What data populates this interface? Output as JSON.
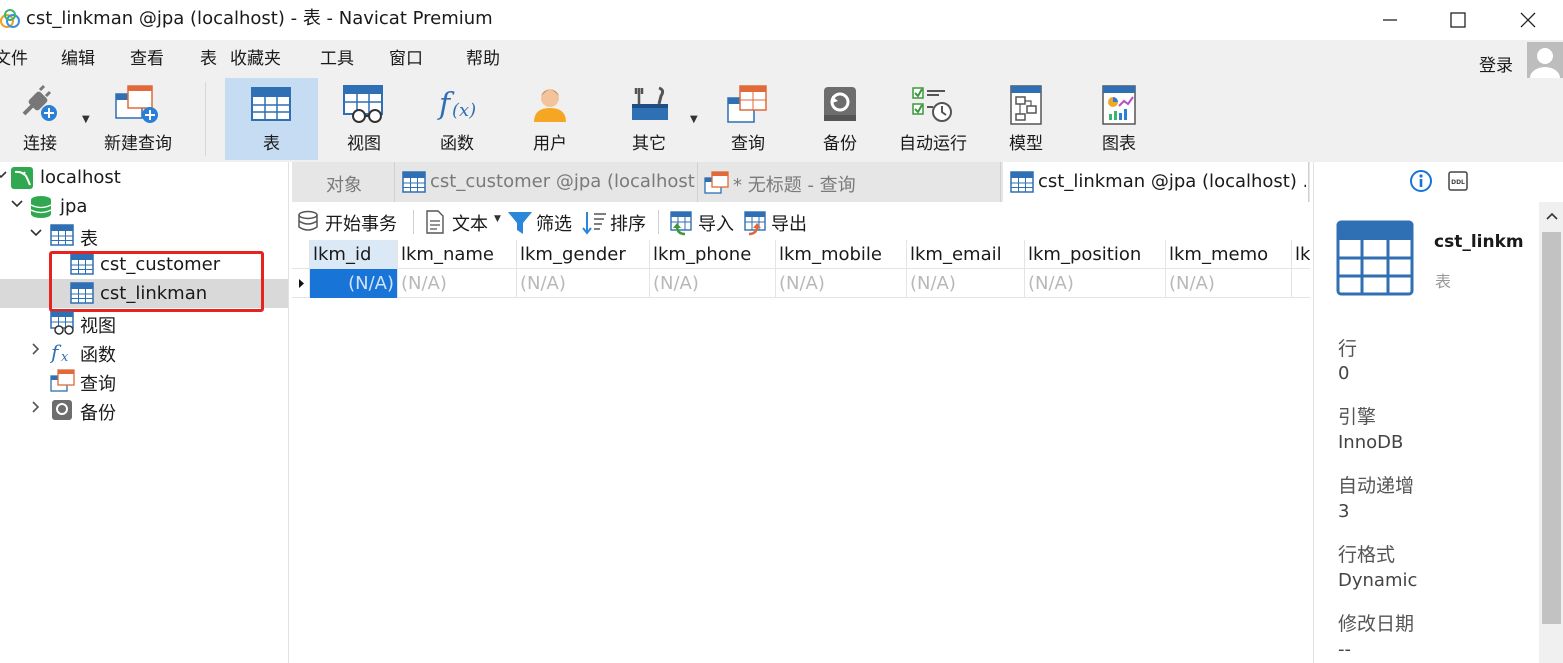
{
  "window": {
    "title": "cst_linkman @jpa (localhost) - 表 - Navicat Premium"
  },
  "menu": {
    "items": [
      "文件",
      "编辑",
      "查看",
      "表",
      "收藏夹",
      "工具",
      "窗口",
      "帮助"
    ],
    "login": "登录"
  },
  "toolbar": {
    "items": [
      "连接",
      "新建查询",
      "表",
      "视图",
      "函数",
      "用户",
      "其它",
      "查询",
      "备份",
      "自动运行",
      "模型",
      "图表"
    ],
    "active": "表"
  },
  "tree": {
    "connection": "localhost",
    "database": "jpa",
    "tables_group": "表",
    "tables": [
      "cst_customer",
      "cst_linkman"
    ],
    "selected_table": "cst_linkman",
    "views": "视图",
    "functions": "函数",
    "queries": "查询",
    "backups": "备份"
  },
  "tabs": [
    {
      "label": "对象",
      "active": false
    },
    {
      "label": "cst_customer @jpa (localhost...",
      "active": false
    },
    {
      "label": "* 无标题 - 查询",
      "active": false
    },
    {
      "label": "cst_linkman @jpa (localhost) ...",
      "active": true
    }
  ],
  "subtoolbar": {
    "begin_transaction": "开始事务",
    "text": "文本",
    "filter": "筛选",
    "sort": "排序",
    "import": "导入",
    "export": "导出"
  },
  "grid": {
    "columns": [
      "lkm_id",
      "lkm_name",
      "lkm_gender",
      "lkm_phone",
      "lkm_mobile",
      "lkm_email",
      "lkm_position",
      "lkm_memo",
      "lk"
    ],
    "row": [
      "(N/A)",
      "(N/A)",
      "(N/A)",
      "(N/A)",
      "(N/A)",
      "(N/A)",
      "(N/A)",
      "(N/A)",
      ""
    ]
  },
  "info": {
    "name": "cst_linkm",
    "type": "表",
    "properties": [
      {
        "label": "行",
        "value": "0"
      },
      {
        "label": "引擎",
        "value": "InnoDB"
      },
      {
        "label": "自动递增",
        "value": "3"
      },
      {
        "label": "行格式",
        "value": "Dynamic"
      },
      {
        "label": "修改日期",
        "value": "--"
      }
    ]
  },
  "colors": {
    "accent": "#1874d6",
    "toolbar_active": "#c6dcf2",
    "highlight": "#e8231f",
    "chrome": "#f0f0f0"
  }
}
